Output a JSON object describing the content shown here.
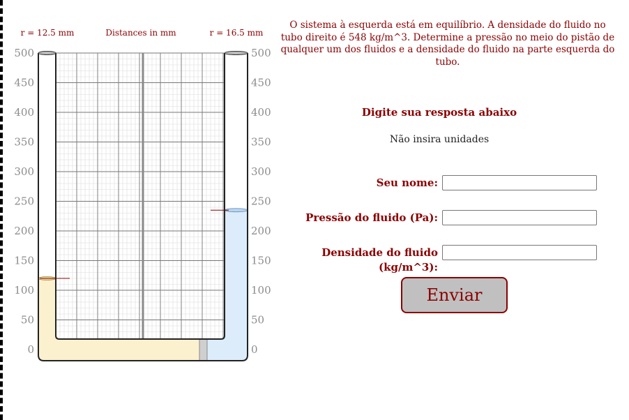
{
  "diagram": {
    "left_radius_label": "r = 12.5 mm",
    "units_label": "Distances in mm",
    "right_radius_label": "r = 16.5 mm",
    "y_ticks": [
      "500",
      "450",
      "400",
      "350",
      "300",
      "250",
      "200",
      "150",
      "100",
      "50",
      "0"
    ],
    "left_fluid_level": 120,
    "right_fluid_level": 235,
    "colors": {
      "left_fluid": "#fbf1cf",
      "right_fluid": "#dcecfb",
      "marker": "#8b0000",
      "tick_text": "#8c8c8c",
      "tube_outline": "#222222"
    }
  },
  "problem": {
    "text": "O sistema à esquerda está em equilíbrio. A densidade do fluido no tubo direito é 548 kg/m^3. Determine a pressão no meio do pistão de qualquer um dos fluidos e a densidade do fluido na parte esquerda do tubo."
  },
  "form": {
    "title": "Digite sua resposta abaixo",
    "note": "Não insira unidades",
    "name_label": "Seu nome:",
    "name_value": "",
    "pressure_label": "Pressão do fluido (Pa):",
    "pressure_value": "",
    "density_label": "Densidade do fluido (kg/m^3):",
    "density_value": "",
    "submit_label": "Enviar"
  }
}
